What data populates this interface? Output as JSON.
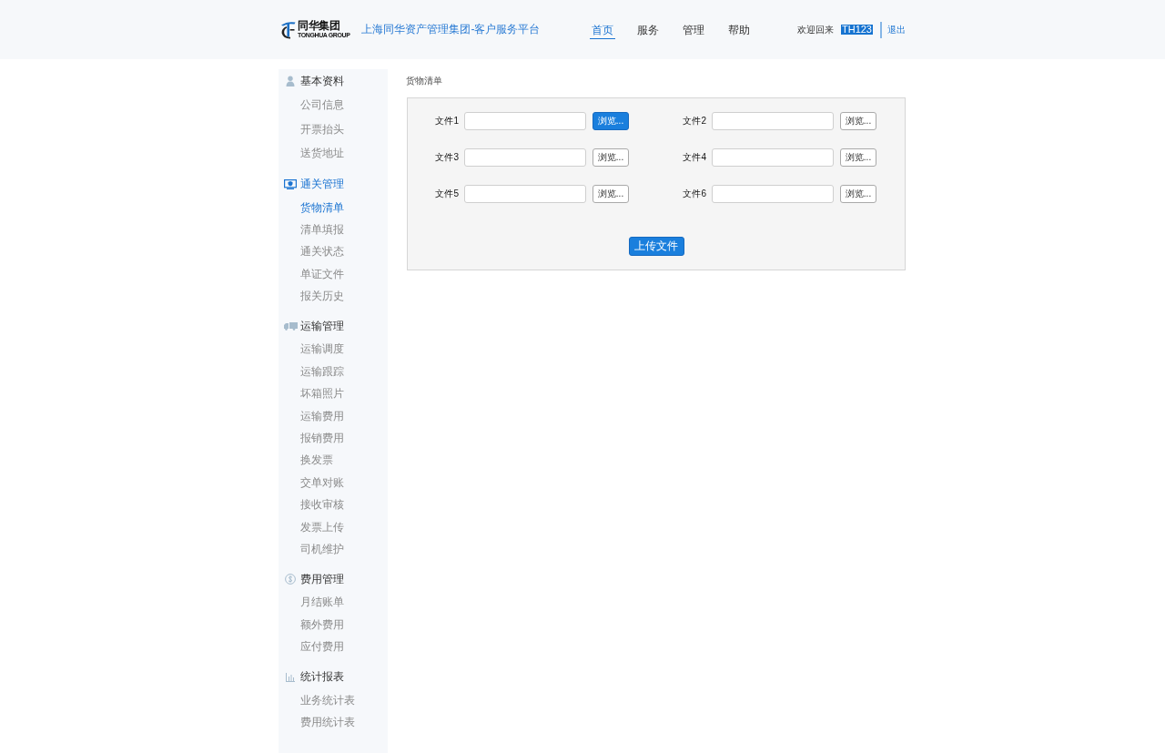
{
  "header": {
    "logo": {
      "name": "同华集团",
      "subtitle": "TONGHUA GROUP"
    },
    "title": "上海同华资产管理集团-客户服务平台",
    "nav": [
      {
        "label": "首页",
        "selected": true
      },
      {
        "label": "服务",
        "selected": false
      },
      {
        "label": "管理",
        "selected": false
      },
      {
        "label": "帮助",
        "selected": false
      }
    ],
    "user": {
      "greeting": "欢迎回来",
      "username": "TH123",
      "logout": "退出"
    }
  },
  "sidebar": {
    "groups": [
      {
        "label": "基本资料",
        "selected": false,
        "items": [
          {
            "label": "公司信息",
            "selected": false
          },
          {
            "label": "开票抬头",
            "selected": false
          },
          {
            "label": "送货地址",
            "selected": false
          }
        ]
      },
      {
        "label": "通关管理",
        "selected": true,
        "items": [
          {
            "label": "货物清单",
            "selected": true
          },
          {
            "label": "清单填报",
            "selected": false
          },
          {
            "label": "通关状态",
            "selected": false
          },
          {
            "label": "单证文件",
            "selected": false
          },
          {
            "label": "报关历史",
            "selected": false
          }
        ]
      },
      {
        "label": "运输管理",
        "selected": false,
        "items": [
          {
            "label": "运输调度",
            "selected": false
          },
          {
            "label": "运输跟踪",
            "selected": false
          },
          {
            "label": "坏箱照片",
            "selected": false
          },
          {
            "label": "运输费用",
            "selected": false
          },
          {
            "label": "报销费用",
            "selected": false
          },
          {
            "label": "换发票",
            "selected": false
          },
          {
            "label": "交单对账",
            "selected": false
          },
          {
            "label": "接收审核",
            "selected": false
          },
          {
            "label": "发票上传",
            "selected": false
          },
          {
            "label": "司机维护",
            "selected": false
          }
        ]
      },
      {
        "label": "费用管理",
        "selected": false,
        "items": [
          {
            "label": "月结账单",
            "selected": false
          },
          {
            "label": "额外费用",
            "selected": false
          },
          {
            "label": "应付费用",
            "selected": false
          }
        ]
      },
      {
        "label": "统计报表",
        "selected": false,
        "items": [
          {
            "label": "业务统计表",
            "selected": false
          },
          {
            "label": "费用统计表",
            "selected": false
          }
        ]
      }
    ]
  },
  "main": {
    "title": "货物清单",
    "files": [
      {
        "label": "文件1",
        "button": "浏览...",
        "focused": true
      },
      {
        "label": "文件2",
        "button": "浏览...",
        "focused": false
      },
      {
        "label": "文件3",
        "button": "浏览...",
        "focused": false
      },
      {
        "label": "文件4",
        "button": "浏览...",
        "focused": false
      },
      {
        "label": "文件5",
        "button": "浏览...",
        "focused": false
      },
      {
        "label": "文件6",
        "button": "浏览...",
        "focused": false
      }
    ],
    "upload_button": "上传文件"
  }
}
